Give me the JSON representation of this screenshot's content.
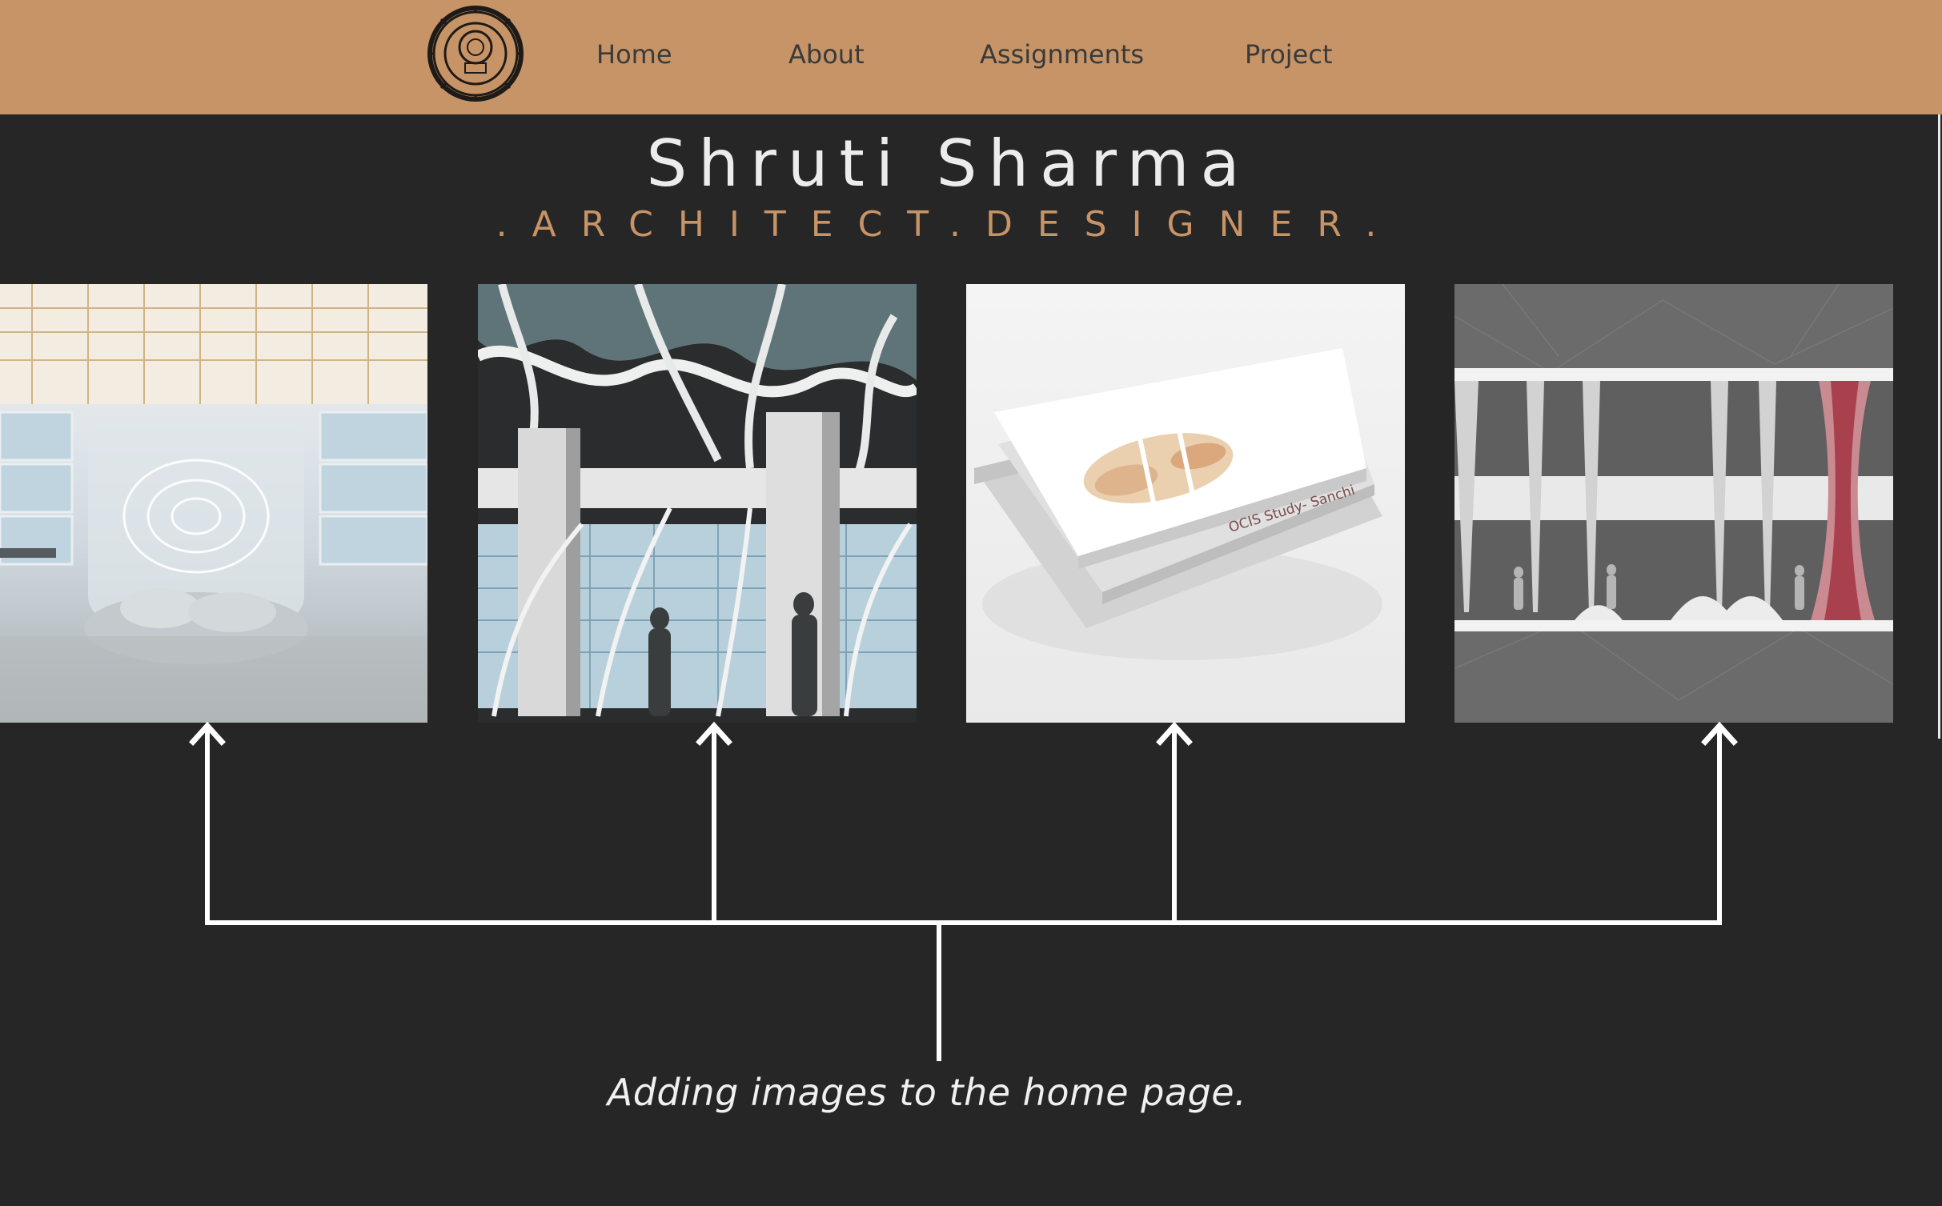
{
  "nav": {
    "links": [
      "Home",
      "About",
      "Assignments",
      "Project"
    ],
    "background_color": "#c69466",
    "logo_icon": "institute-emblem-icon"
  },
  "header": {
    "title": "Shruti Sharma",
    "subtitle": ".ARCHITECT.DESIGNER."
  },
  "gallery": {
    "items": [
      {
        "icon": "interior-render-icon"
      },
      {
        "icon": "canopy-structure-render-icon"
      },
      {
        "icon": "book-mockup-icon",
        "book_text": "OCIS Study- Sanchi"
      },
      {
        "icon": "column-section-drawing-icon"
      }
    ]
  },
  "annotation": {
    "caption": "Adding images to the home page.",
    "arrow_color": "#ffffff"
  },
  "colors": {
    "page_background": "#262626",
    "title": "#ececec",
    "subtitle": "#c69466"
  }
}
